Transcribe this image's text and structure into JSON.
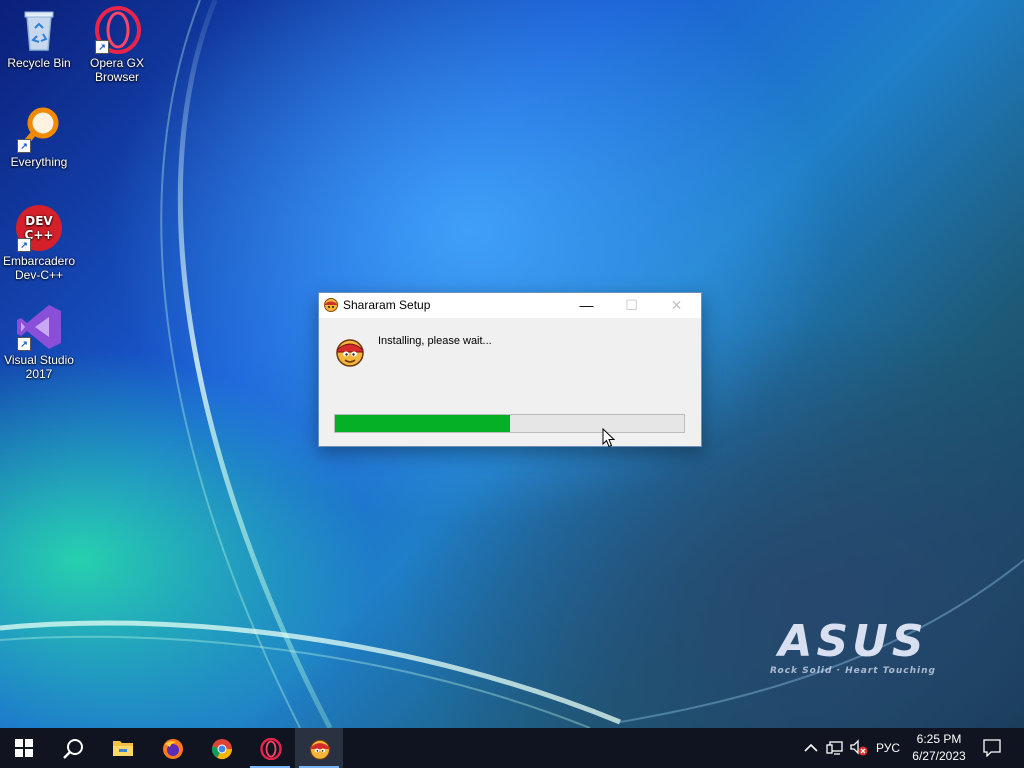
{
  "desktop": {
    "icons": [
      {
        "label": "Recycle Bin",
        "icon": "recycle-bin-icon"
      },
      {
        "label": "Opera GX Browser",
        "icon": "opera-gx-icon"
      },
      {
        "label": "Everything",
        "icon": "everything-search-icon"
      },
      {
        "label": "Embarcadero Dev-C++",
        "icon": "dev-cpp-icon"
      },
      {
        "label": "Visual Studio 2017",
        "icon": "visual-studio-icon"
      }
    ],
    "dev_cpp_badge": "DEV\nC++",
    "wallpaper_logo": "ASUS",
    "wallpaper_tagline": "Rock Solid · Heart Touching"
  },
  "dialog": {
    "title": "Shararam Setup",
    "status": "Installing, please wait...",
    "progress_fraction": 0.5,
    "minimize_glyph": "—",
    "maximize_glyph": "☐",
    "close_glyph": "✕",
    "accent_progress": "#06b025"
  },
  "taskbar": {
    "pinned": [
      {
        "icon": "windows-start-icon"
      },
      {
        "icon": "search-icon"
      },
      {
        "icon": "file-explorer-icon"
      },
      {
        "icon": "firefox-icon"
      },
      {
        "icon": "chrome-icon"
      },
      {
        "icon": "opera-gx-icon"
      },
      {
        "icon": "shararam-setup-icon"
      }
    ],
    "tray": {
      "language": "РУС",
      "time": "6:25 PM",
      "date": "6/27/2023",
      "icons": [
        "chevron-up-icon",
        "network-icon",
        "volume-muted-icon",
        "notification-icon"
      ]
    }
  }
}
